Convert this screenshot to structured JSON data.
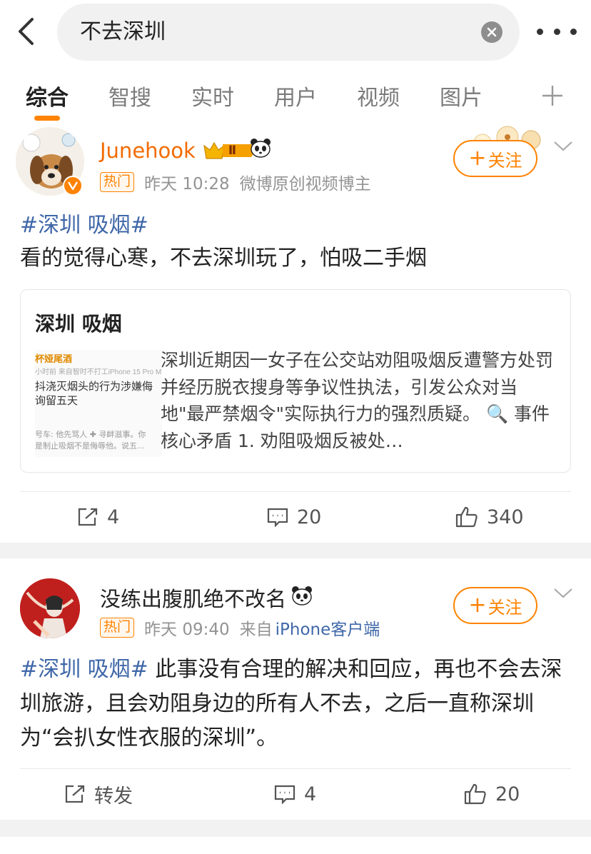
{
  "search": {
    "query": "不去深圳"
  },
  "tabs": [
    {
      "label": "综合"
    },
    {
      "label": "智搜"
    },
    {
      "label": "实时"
    },
    {
      "label": "用户"
    },
    {
      "label": "视频"
    },
    {
      "label": "图片"
    }
  ],
  "posts": [
    {
      "username": "Junehook",
      "level_badge": "Ⅱ",
      "hot_tag": "热门",
      "time": "昨天 10:28",
      "source": "微博原创视频博主",
      "follow_label": "关注",
      "hashtag": "#深圳 吸烟#",
      "text": "看的觉得心寒，不去深圳玩了，怕吸二手烟",
      "card": {
        "title": "深圳 吸烟",
        "thumb_lines": [
          "杯娅尾酒",
          "小时前  来自智时不打工iPhone 15 Pro M",
          "抖浇灭烟头的行为涉嫌侮",
          "询留五天",
          "号车: 他先骂人 ✚ 寻衅滋事。你",
          "是制止吸烟不是侮辱他。说五..."
        ],
        "body": "深圳近期因一女子在公交站劝阻吸烟反遭警方处罚并经历脱衣搜身等争议性执法，引发公众对当地\"最严禁烟令\"实际执行力的强烈质疑。 🔍 事件核心矛盾 1. 劝阻吸烟反被处…"
      },
      "actions": {
        "repost": "4",
        "comment": "20",
        "like": "340"
      },
      "accent": "#ff8200"
    },
    {
      "username": "没练出腹肌绝不改名",
      "hot_tag": "热门",
      "time": "昨天 09:40",
      "source_prefix": "来自",
      "source_link": "iPhone客户端",
      "follow_label": "关注",
      "hashtag": "#深圳 吸烟#",
      "text": " 此事没有合理的解决和回应，再也不会去深圳旅游，且会劝阻身边的所有人不去，之后一直称深圳为“会扒女性衣服的深圳”。",
      "actions": {
        "repost": "转发",
        "comment": "4",
        "like": "20"
      }
    }
  ],
  "colors": {
    "accent": "#ff8200",
    "link": "#3f67a8",
    "username_orange": "#f26b00"
  }
}
